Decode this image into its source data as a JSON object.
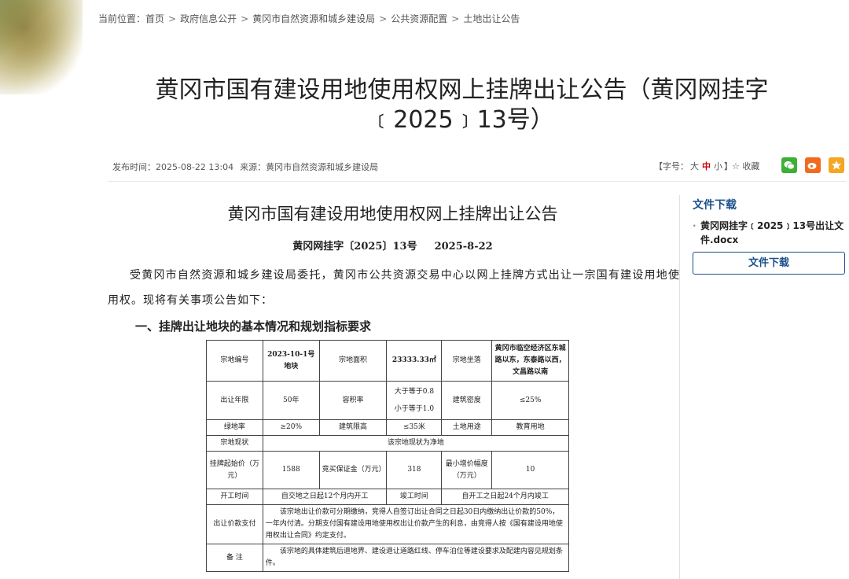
{
  "breadcrumb": {
    "prefix": "当前位置：",
    "items": [
      "首页",
      "政府信息公开",
      "黄冈市自然资源和城乡建设局",
      "公共资源配置",
      "土地出让公告"
    ],
    "sep": ">"
  },
  "article": {
    "title": "黄冈市国有建设用地使用权网上挂牌出让公告（黄冈网挂字﹝2025﹞13号）",
    "publish_time": "发布时间：2025-08-22 13:04",
    "source": "来源：黄冈市自然资源和城乡建设局"
  },
  "toolbar": {
    "font_prefix": "【字号：",
    "font_big": "大",
    "font_mid": "中",
    "font_small": "小",
    "font_suffix": "】",
    "favorite": "收藏"
  },
  "share_icons": [
    "wechat-icon",
    "weibo-icon",
    "qzone-icon"
  ],
  "doc": {
    "title": "黄冈市国有建设用地使用权网上挂牌出让公告",
    "number": "黄冈网挂字〔2025〕13号",
    "date": "2025-8-22",
    "intro": "受黄冈市自然资源和城乡建设局委托，黄冈市公共资源交易中心以网上挂牌方式出让一宗国有建设用地使用权。现将有关事项公告如下：",
    "section1": "一、挂牌出让地块的基本情况和规划指标要求"
  },
  "table": {
    "r1": [
      "宗地编号",
      "2023-10-1号地块",
      "宗地面积",
      "23333.33㎡",
      "宗地坐落",
      "黄冈市临空经济区东城路以东，东泰路以西，文昌路以南"
    ],
    "r2": [
      "出让年限",
      "50年",
      "容积率",
      "大于等于0.8",
      "小于等于1.0",
      "建筑密度",
      "≤25%"
    ],
    "r3": [
      "绿地率",
      "≥20%",
      "建筑限高",
      "≤35米",
      "土地用途",
      "教育用地"
    ],
    "r4": [
      "宗地现状",
      "该宗地现状为净地"
    ],
    "r5": [
      "挂牌起始价（万元）",
      "1588",
      "竞买保证金（万元）",
      "318",
      "最小增价幅度（万元）",
      "10"
    ],
    "r6": [
      "开工时间",
      "自交地之日起12个月内开工",
      "竣工时间",
      "自开工之日起24个月内竣工"
    ],
    "r7": [
      "出让价款支付",
      "该宗地出让价款可分期缴纳，竞得人自签订出让合同之日起30日内缴纳出让价款的50%，一年内付清。分期支付国有建设用地使用权出让价款产生的利息，由竞得人按《国有建设用地使用权出让合同》约定支付。"
    ],
    "r8": [
      "备  注",
      "该宗地的具体建筑后退地界、建设退让道路红线、停车泊位等建设要求及配建内容见规划条件。"
    ]
  },
  "sidebar": {
    "title": "文件下载",
    "file_name": "黄冈网挂字﹝2025﹞13号出让文件.docx",
    "download_label": "文件下载"
  }
}
